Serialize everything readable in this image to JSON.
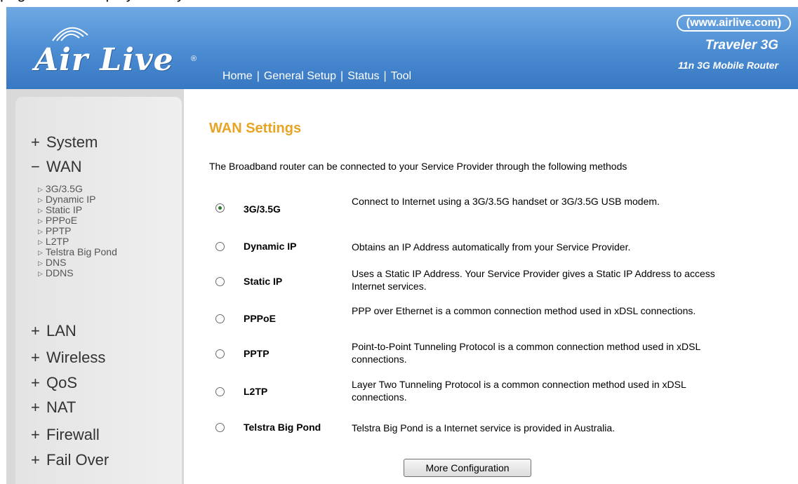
{
  "browser_caption": "page will be displayed on your web browser.",
  "header": {
    "logo_text": "Air Live",
    "logo_reg": "®",
    "nav": [
      "Home",
      "General Setup",
      "Status",
      "Tool"
    ],
    "nav_separator": "|",
    "site_url": "(www.airlive.com)",
    "product_name": "Traveler 3G",
    "product_subtitle": "11n 3G Mobile Router"
  },
  "sidebar": {
    "main_items": [
      {
        "sign": "+",
        "label": "System"
      },
      {
        "sign": "−",
        "label": "WAN"
      },
      {
        "sign": "+",
        "label": "LAN"
      },
      {
        "sign": "+",
        "label": "Wireless"
      },
      {
        "sign": "+",
        "label": "QoS"
      },
      {
        "sign": "+",
        "label": "NAT"
      },
      {
        "sign": "+",
        "label": "Firewall"
      },
      {
        "sign": "+",
        "label": "Fail Over"
      }
    ],
    "wan_submenu": [
      "3G/3.5G",
      "Dynamic IP",
      "Static IP",
      "PPPoE",
      "PPTP",
      "L2TP",
      "Telstra Big Pond",
      "DNS",
      "DDNS"
    ],
    "submenu_marker": "▷"
  },
  "main": {
    "title": "WAN Settings",
    "intro": "The Broadband router can be connected to your Service Provider through the following methods",
    "options": [
      {
        "label": "3G/3.5G",
        "selected": true,
        "description": "Connect to Internet using a 3G/3.5G handset or 3G/3.5G USB modem."
      },
      {
        "label": "Dynamic IP",
        "selected": false,
        "description": "Obtains an IP Address automatically from your Service Provider."
      },
      {
        "label": "Static IP",
        "selected": false,
        "description": "Uses a Static IP Address. Your Service Provider gives a Static IP Address to access Internet services."
      },
      {
        "label": "PPPoE",
        "selected": false,
        "description": "PPP over Ethernet is a common connection method used in xDSL connections."
      },
      {
        "label": "PPTP",
        "selected": false,
        "description": "Point-to-Point Tunneling Protocol is a common connection method used in xDSL connections."
      },
      {
        "label": "L2TP",
        "selected": false,
        "description": "Layer Two Tunneling Protocol is a common connection method used in xDSL connections."
      },
      {
        "label": "Telstra Big Pond",
        "selected": false,
        "description": "Telstra Big Pond is a Internet service is provided in Australia."
      }
    ],
    "more_button": "More Configuration"
  },
  "colors": {
    "header_blue": "#4a8bd2",
    "title_orange": "#e8a424",
    "radio_selected": "#2a7a2a"
  }
}
